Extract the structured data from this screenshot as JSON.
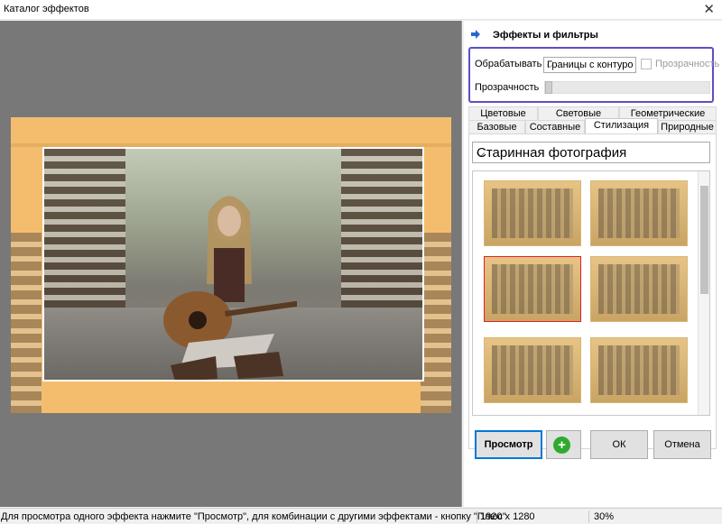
{
  "window": {
    "title": "Каталог эффектов",
    "close_glyph": "✕"
  },
  "panel": {
    "header": "Эффекты и фильтры",
    "process_label": "Обрабатывать",
    "process_value": "Границы с контуро",
    "transparency_checkbox_label": "Прозрачность",
    "transparency_slider_label": "Прозрачность",
    "transparency_value": 0,
    "tabs_top": [
      "Цветовые",
      "Световые",
      "Геометрические"
    ],
    "tabs_bottom": [
      "Базовые",
      "Составные",
      "Стилизация",
      "Природные"
    ],
    "active_tab": "Стилизация",
    "effect_select": "Старинная фотография",
    "thumbnails": [
      "vintage-1",
      "vintage-2",
      "vintage-3",
      "vintage-4",
      "vintage-5",
      "vintage-6"
    ],
    "selected_thumbnail": 2
  },
  "buttons": {
    "preview": "Просмотр",
    "ok": "ОК",
    "cancel": "Отмена"
  },
  "status": {
    "hint": "Для просмотра одного эффекта нажмите \"Просмотр\", для комбинации с другими эффектами - кнопку \"Плюс\"",
    "resolution": "1920 x 1280",
    "zoom": "30%"
  },
  "colors": {
    "accent_border": "#5b4fc6",
    "primary_button_border": "#0078d7",
    "selected_thumb": "#e02020",
    "plus_button": "#2faa2f"
  }
}
